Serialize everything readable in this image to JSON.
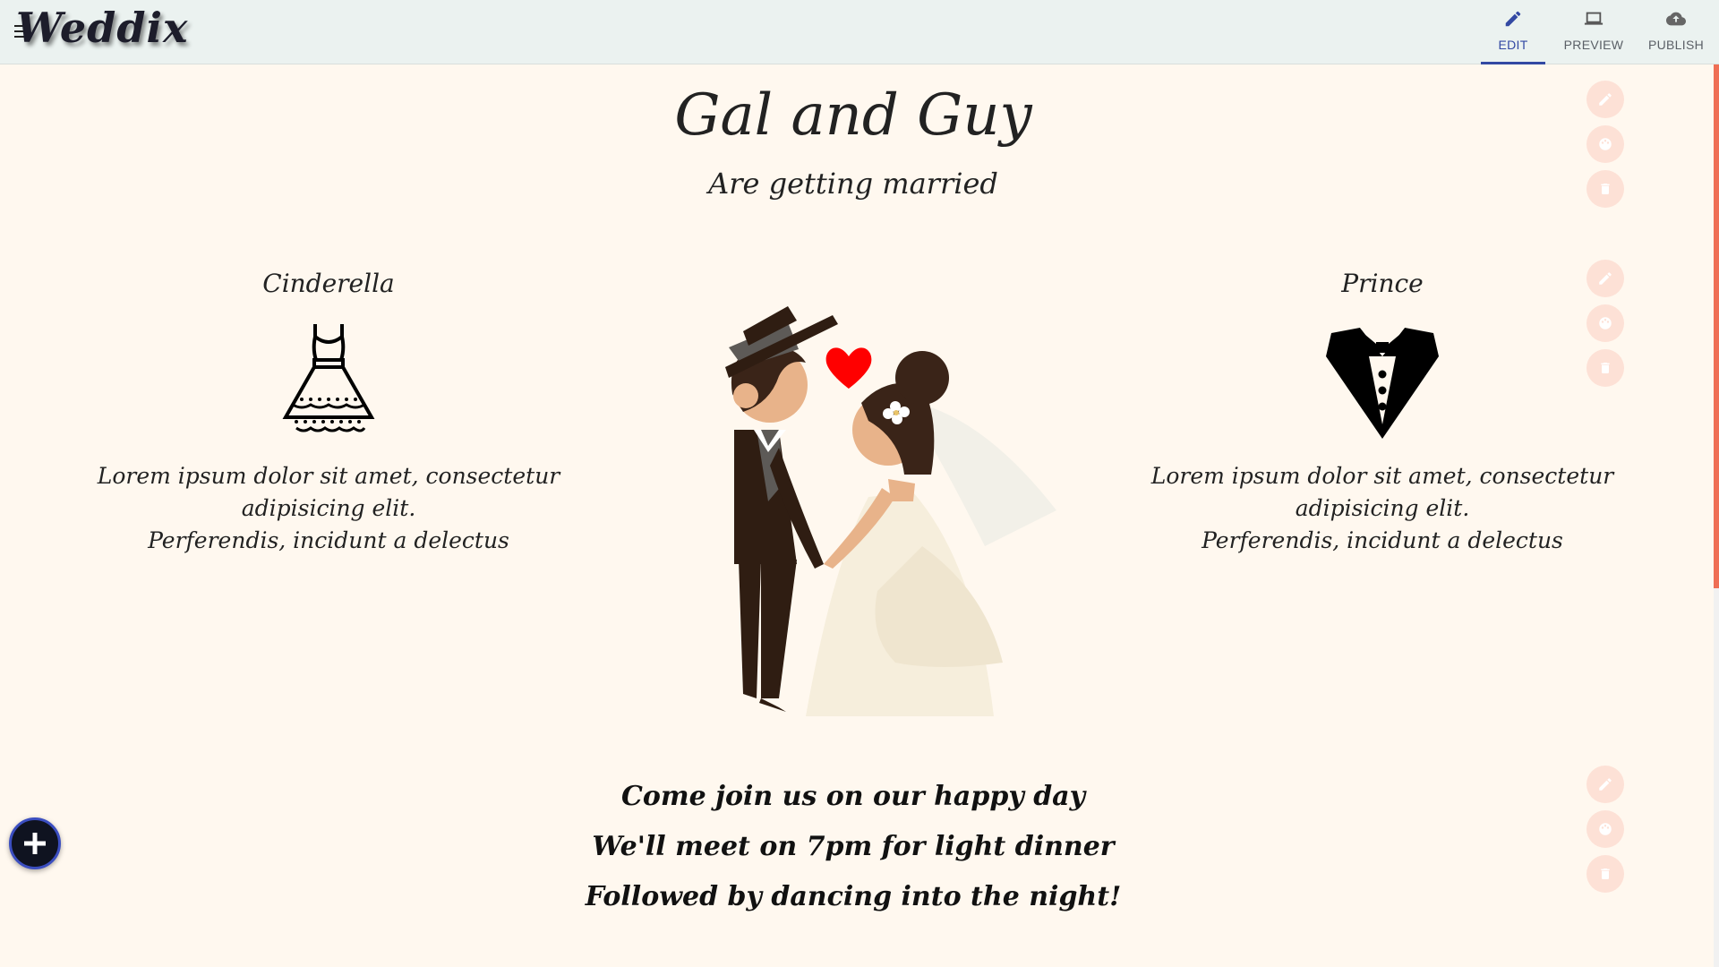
{
  "header": {
    "logo": "Weddix",
    "nav": [
      {
        "label": "EDIT",
        "icon": "pencil-icon",
        "active": true
      },
      {
        "label": "PREVIEW",
        "icon": "laptop-icon",
        "active": false
      },
      {
        "label": "PUBLISH",
        "icon": "cloud-upload-icon",
        "active": false
      }
    ]
  },
  "hero": {
    "title": "Gal and Guy",
    "subtitle": "Are getting married"
  },
  "bride": {
    "name": "Cinderella",
    "icon": "dress-icon",
    "text_line1": "Lorem ipsum dolor sit amet, consectetur adipisicing elit.",
    "text_line2": "Perferendis, incidunt a delectus"
  },
  "groom": {
    "name": "Prince",
    "icon": "tuxedo-icon",
    "text_line1": "Lorem ipsum dolor sit amet, consectetur adipisicing elit.",
    "text_line2": "Perferendis, incidunt a delectus"
  },
  "invitation": {
    "line1": "Come join us on our happy day",
    "line2": "We'll meet on 7pm for light dinner",
    "line3": "Followed by dancing into the night!"
  },
  "section_tools": [
    "pencil-icon",
    "palette-icon",
    "trash-icon"
  ],
  "colors": {
    "background": "#fff8ef",
    "header": "#ebf2f0",
    "accent": "#3349a3",
    "tool_button": "#fde1d6",
    "scrollbar": "#ef6f55"
  }
}
